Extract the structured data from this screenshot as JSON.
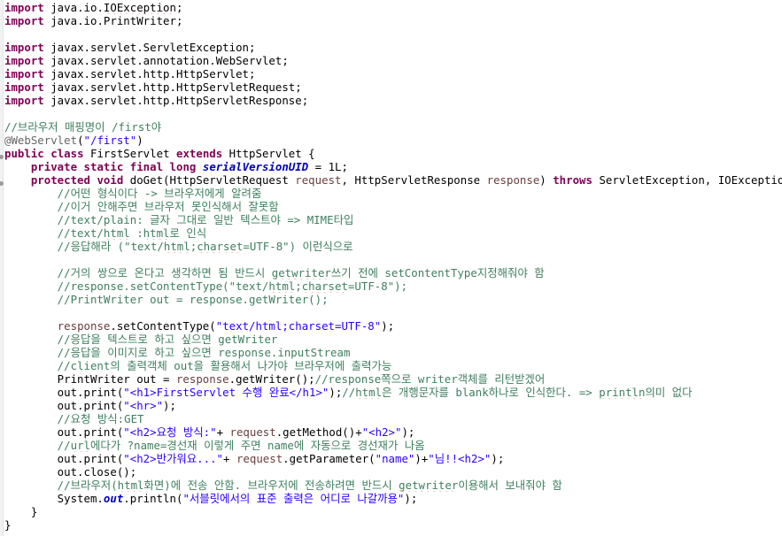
{
  "editor": {
    "colors": {
      "keyword": "#7f0055",
      "string": "#2a00ff",
      "comment": "#3f7f5f",
      "annotation": "#646464",
      "field": "#0000c0",
      "parameter": "#6a3e3e"
    },
    "lines": [
      [
        {
          "c": "kw",
          "t": "import"
        },
        {
          "c": "",
          "t": " java.io."
        },
        {
          "c": "spell",
          "t": "IOException"
        },
        {
          "c": "",
          "t": ";"
        }
      ],
      [
        {
          "c": "kw",
          "t": "import"
        },
        {
          "c": "",
          "t": " java.io.PrintWriter;"
        }
      ],
      [],
      [
        {
          "c": "kw",
          "t": "import"
        },
        {
          "c": "",
          "t": " javax.servlet.ServletException;"
        }
      ],
      [
        {
          "c": "kw",
          "t": "import"
        },
        {
          "c": "",
          "t": " javax.servlet.annotation.WebServlet;"
        }
      ],
      [
        {
          "c": "kw",
          "t": "import"
        },
        {
          "c": "",
          "t": " javax.servlet.http.HttpServlet;"
        }
      ],
      [
        {
          "c": "kw",
          "t": "import"
        },
        {
          "c": "",
          "t": " javax.servlet.http.HttpServletRequest;"
        }
      ],
      [
        {
          "c": "kw",
          "t": "import"
        },
        {
          "c": "",
          "t": " javax.servlet.http.HttpServletResponse;"
        }
      ],
      [],
      [
        {
          "c": "cm",
          "t": "//브라우저 매핑명이 /first야"
        }
      ],
      [
        {
          "c": "ann",
          "t": "@WebServlet"
        },
        {
          "c": "",
          "t": "("
        },
        {
          "c": "str",
          "t": "\"/first\""
        },
        {
          "c": "",
          "t": ")"
        }
      ],
      [
        {
          "c": "kw",
          "t": "public"
        },
        {
          "c": "",
          "t": " "
        },
        {
          "c": "kw",
          "t": "class"
        },
        {
          "c": "",
          "t": " FirstServlet "
        },
        {
          "c": "kw",
          "t": "extends"
        },
        {
          "c": "",
          "t": " HttpServlet {"
        }
      ],
      [
        {
          "c": "",
          "t": "    "
        },
        {
          "c": "kw",
          "t": "private"
        },
        {
          "c": "",
          "t": " "
        },
        {
          "c": "kw",
          "t": "static"
        },
        {
          "c": "",
          "t": " "
        },
        {
          "c": "kw",
          "t": "final"
        },
        {
          "c": "",
          "t": " "
        },
        {
          "c": "kw",
          "t": "long"
        },
        {
          "c": "",
          "t": " "
        },
        {
          "c": "sfld",
          "t": "serialVersionUID"
        },
        {
          "c": "",
          "t": " = 1L;"
        }
      ],
      [
        {
          "c": "",
          "t": "    "
        },
        {
          "c": "kw",
          "t": "protected"
        },
        {
          "c": "",
          "t": " "
        },
        {
          "c": "kw",
          "t": "void"
        },
        {
          "c": "",
          "t": " doGet(HttpServletRequest "
        },
        {
          "c": "par",
          "t": "request"
        },
        {
          "c": "",
          "t": ", HttpServletResponse "
        },
        {
          "c": "par",
          "t": "response"
        },
        {
          "c": "",
          "t": ") "
        },
        {
          "c": "kw",
          "t": "throws"
        },
        {
          "c": "",
          "t": " ServletException, IOException {"
        }
      ],
      [
        {
          "c": "cm",
          "t": "        //어떤 형식이다 -> 브라우저에게 알려줌"
        }
      ],
      [
        {
          "c": "cm",
          "t": "        //이거 안해주면 브라우저 못인식해서 잘못함"
        }
      ],
      [
        {
          "c": "cm",
          "t": "        //text/plain: 글자 그대로 일반 텍스트야 => MIME타입"
        }
      ],
      [
        {
          "c": "cm",
          "t": "        //text/"
        },
        {
          "c": "cm spell",
          "t": "html"
        },
        {
          "c": "cm",
          "t": " :"
        },
        {
          "c": "cm spell",
          "t": "html"
        },
        {
          "c": "cm",
          "t": "로 인식"
        }
      ],
      [
        {
          "c": "cm",
          "t": "        //응답해라 (\"text/"
        },
        {
          "c": "cm spell",
          "t": "html"
        },
        {
          "c": "cm",
          "t": ";"
        },
        {
          "c": "cm spell",
          "t": "charset"
        },
        {
          "c": "cm",
          "t": "=UTF-8\") 이런식으로"
        }
      ],
      [],
      [
        {
          "c": "cm",
          "t": "        //거의 쌍으로 온다고 생각하면 됨 반드시 "
        },
        {
          "c": "cm spell",
          "t": "getwriter"
        },
        {
          "c": "cm",
          "t": "쓰기 전에 setContentType지정해줘야 함"
        }
      ],
      [
        {
          "c": "cm",
          "t": "        //response.setContentType(\"text/"
        },
        {
          "c": "cm spell",
          "t": "html"
        },
        {
          "c": "cm",
          "t": ";"
        },
        {
          "c": "cm spell",
          "t": "charset"
        },
        {
          "c": "cm",
          "t": "=UTF-8\");"
        }
      ],
      [
        {
          "c": "cm",
          "t": "        //PrintWriter out = response.getWriter();"
        }
      ],
      [],
      [
        {
          "c": "",
          "t": "        "
        },
        {
          "c": "par",
          "t": "response"
        },
        {
          "c": "",
          "t": ".setContentType("
        },
        {
          "c": "str",
          "t": "\"text/html;charset=UTF-8\""
        },
        {
          "c": "",
          "t": ");"
        }
      ],
      [
        {
          "c": "cm",
          "t": "        //응답을 텍스트로 하고 싶으면 getWriter"
        }
      ],
      [
        {
          "c": "cm",
          "t": "        //응답을 이미지로 하고 싶으면 response.inputStream"
        }
      ],
      [
        {
          "c": "cm",
          "t": "        //client의 출력객체 out을 활용해서 나가야 브라우저에 출력가능"
        }
      ],
      [
        {
          "c": "",
          "t": "        PrintWriter out = "
        },
        {
          "c": "par",
          "t": "response"
        },
        {
          "c": "",
          "t": ".getWriter();"
        },
        {
          "c": "cm",
          "t": "//response쪽으로 writer객체를 리턴받겠어"
        }
      ],
      [
        {
          "c": "",
          "t": "        out.print("
        },
        {
          "c": "str",
          "t": "\"<h1>FirstServlet 수행 완료</h1>\""
        },
        {
          "c": "",
          "t": ");"
        },
        {
          "c": "cm",
          "t": "//"
        },
        {
          "c": "cm spell",
          "t": "html"
        },
        {
          "c": "cm",
          "t": "은 개행문자를 blank하나로 인식한다. => "
        },
        {
          "c": "cm spell",
          "t": "println"
        },
        {
          "c": "cm",
          "t": "의미 없다"
        }
      ],
      [
        {
          "c": "",
          "t": "        out.print("
        },
        {
          "c": "str",
          "t": "\"<hr>\""
        },
        {
          "c": "",
          "t": ");"
        }
      ],
      [
        {
          "c": "cm",
          "t": "        //요청 방식:GET"
        }
      ],
      [
        {
          "c": "",
          "t": "        out.print("
        },
        {
          "c": "str",
          "t": "\"<h2>요청 방식:\""
        },
        {
          "c": "",
          "t": "+ "
        },
        {
          "c": "par",
          "t": "request"
        },
        {
          "c": "",
          "t": ".getMethod()+"
        },
        {
          "c": "str",
          "t": "\"<h2>\""
        },
        {
          "c": "",
          "t": ");"
        }
      ],
      [
        {
          "c": "cm",
          "t": "        //"
        },
        {
          "c": "cm spell",
          "t": "url"
        },
        {
          "c": "cm",
          "t": "에다가 ?name=경선재 이렇게 주면 name에 자동으로 경선재가 나옴"
        }
      ],
      [
        {
          "c": "",
          "t": "        out.print("
        },
        {
          "c": "str",
          "t": "\"<h2>반가워요...\""
        },
        {
          "c": "",
          "t": "+ "
        },
        {
          "c": "par",
          "t": "request"
        },
        {
          "c": "",
          "t": ".getParameter("
        },
        {
          "c": "str",
          "t": "\"name\""
        },
        {
          "c": "",
          "t": ")+"
        },
        {
          "c": "str",
          "t": "\"님!!<h2>\""
        },
        {
          "c": "",
          "t": ");"
        }
      ],
      [
        {
          "c": "",
          "t": "        out.close();"
        }
      ],
      [
        {
          "c": "cm",
          "t": "        //브라우저("
        },
        {
          "c": "cm spell",
          "t": "html"
        },
        {
          "c": "cm",
          "t": "화면)에 전송 안함. 브라우저에 전송하려면 반드시 "
        },
        {
          "c": "cm spell",
          "t": "getwriter"
        },
        {
          "c": "cm",
          "t": "이용해서 보내줘야 함"
        }
      ],
      [
        {
          "c": "",
          "t": "        System."
        },
        {
          "c": "fld",
          "t": "out"
        },
        {
          "c": "",
          "t": ".println("
        },
        {
          "c": "str",
          "t": "\"서블릿에서의 표준 출력은 어디로 나갈까용\""
        },
        {
          "c": "",
          "t": ");"
        }
      ],
      [
        {
          "c": "",
          "t": "    }"
        }
      ],
      [
        {
          "c": "",
          "t": "}"
        }
      ]
    ]
  }
}
